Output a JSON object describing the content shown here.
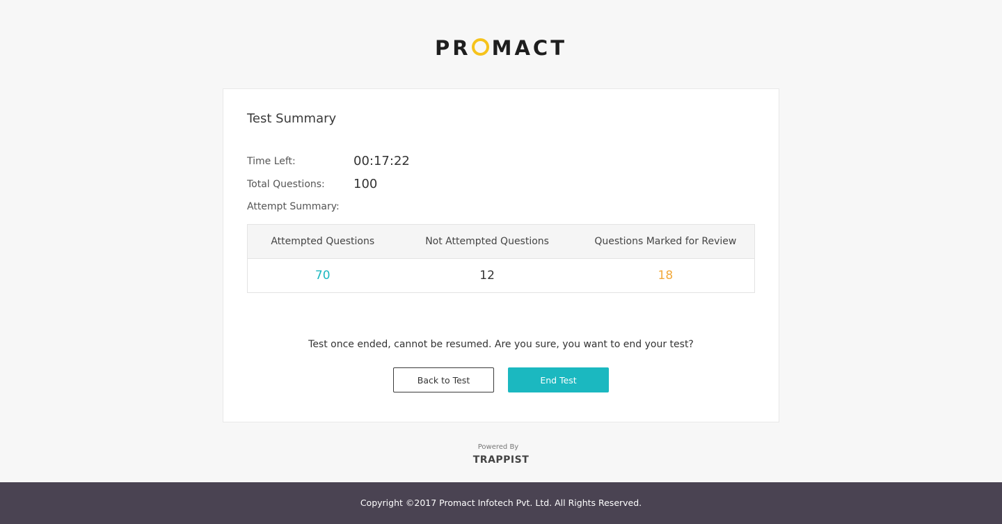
{
  "brand": {
    "logo_prefix": "PR",
    "logo_suffix": "MACT",
    "logo_o_color": "#f6c31c"
  },
  "summary": {
    "title": "Test Summary",
    "time_left_label": "Time Left:",
    "time_left_value": "00:17:22",
    "total_questions_label": "Total Questions:",
    "total_questions_value": "100",
    "attempt_summary_label": "Attempt Summary:",
    "table": {
      "headers": [
        "Attempted Questions",
        "Not Attempted Questions",
        "Questions Marked for Review"
      ],
      "values": [
        "70",
        "12",
        "18"
      ],
      "value_colors": [
        "#1bb8c0",
        "#333333",
        "#f2a93b"
      ]
    }
  },
  "confirm": {
    "message": "Test once ended, cannot be resumed. Are you sure, you want to end your test?",
    "back_label": "Back to Test",
    "end_label": "End Test"
  },
  "powered": {
    "label": "Powered By",
    "brand": "TRAPPIST"
  },
  "footer": {
    "copyright": "Copyright ©2017 Promact Infotech Pvt. Ltd. All Rights Reserved."
  },
  "colors": {
    "accent": "#1bb8c0",
    "review": "#f2a93b",
    "footer_bg": "#4a4352"
  }
}
